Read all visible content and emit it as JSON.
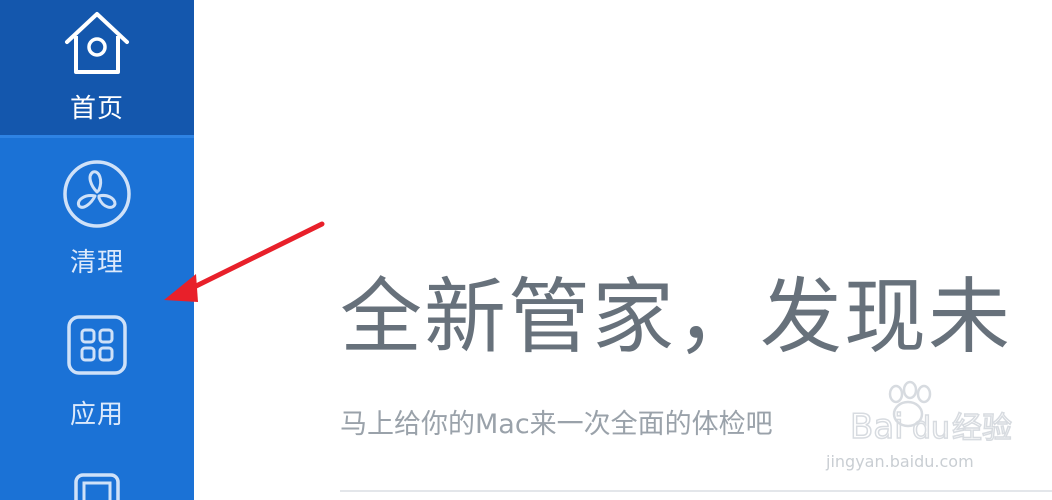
{
  "sidebar": {
    "items": [
      {
        "label": "首页",
        "icon": "house-icon",
        "active": true
      },
      {
        "label": "清理",
        "icon": "fan-icon",
        "active": false
      },
      {
        "label": "应用",
        "icon": "apps-grid-icon",
        "active": false
      },
      {
        "label": "",
        "icon": "device-icon",
        "active": false
      }
    ]
  },
  "main": {
    "headline": "全新管家，发现未",
    "subline": "马上给你的Mac来一次全面的体检吧"
  },
  "watermark": {
    "brand": "Baidu 经验",
    "domain": "jingyan.baidu.com"
  },
  "colors": {
    "sidebar": "#1b72d6",
    "sidebar_active": "#1457ad",
    "headline": "#67717b",
    "subline": "#9aa2aa",
    "annotation_arrow": "#e8202a"
  }
}
